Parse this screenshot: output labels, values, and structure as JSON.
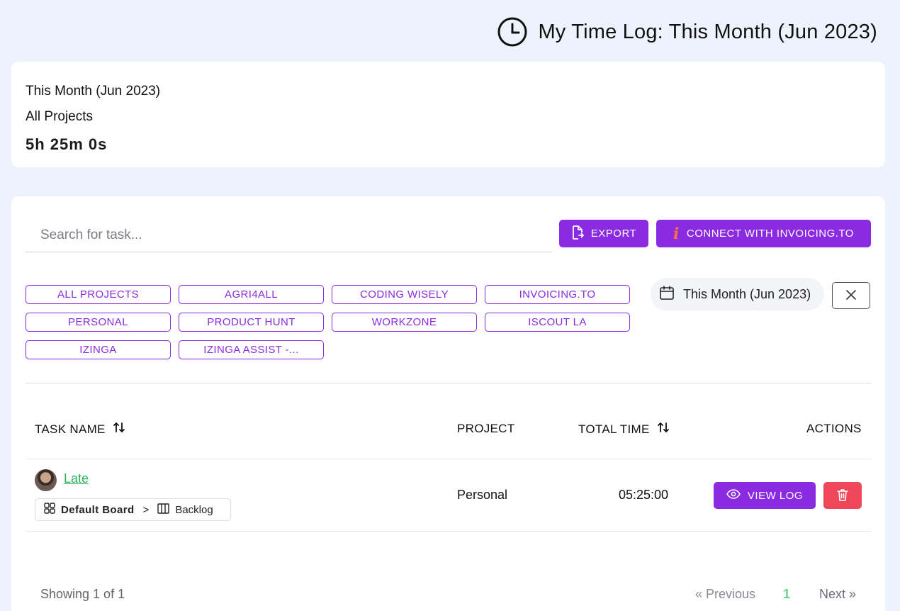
{
  "header": {
    "title": "My Time Log: This Month (Jun 2023)",
    "icon": "clock-icon"
  },
  "summary": {
    "period": "This Month (Jun 2023)",
    "scope": "All Projects",
    "total": "5h 25m 0s"
  },
  "toolbar": {
    "search_placeholder": "Search for task...",
    "export_label": "EXPORT",
    "connect_label": "CONNECT WITH INVOICING.TO",
    "connect_icon_glyph": "i"
  },
  "filters": {
    "projects": [
      "ALL PROJECTS",
      "AGRI4ALL",
      "CODING WISELY",
      "INVOICING.TO",
      "PERSONAL",
      "PRODUCT HUNT",
      "WORKZONE",
      "ISCOUT LA",
      "IZINGA",
      "IZINGA ASSIST -..."
    ],
    "date_range": "This Month (Jun 2023)"
  },
  "table": {
    "columns": {
      "task": "TASK NAME",
      "project": "PROJECT",
      "total": "TOTAL TIME",
      "actions": "ACTIONS"
    },
    "rows": [
      {
        "task": "Late",
        "board": "Default Board",
        "separator": ">",
        "list": "Backlog",
        "project": "Personal",
        "total": "05:25:00",
        "view_label": "VIEW LOG"
      }
    ]
  },
  "pagination": {
    "showing": "Showing 1 of 1",
    "previous": "« Previous",
    "current": "1",
    "next": "Next »"
  },
  "colors": {
    "accent": "#8a2be2",
    "link": "#2eaf5c",
    "danger": "#ef4658",
    "background": "#eef2fd"
  }
}
